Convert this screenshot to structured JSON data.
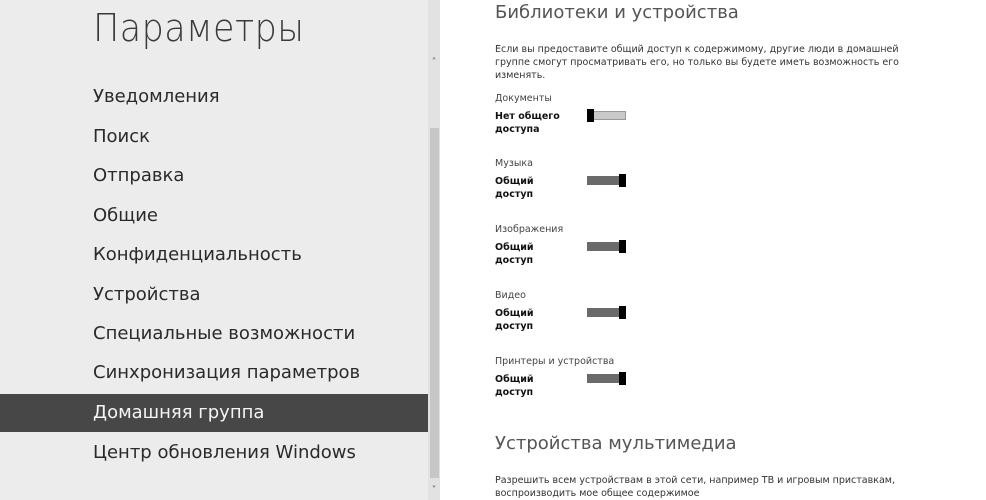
{
  "left": {
    "title": "Параметры",
    "items": [
      {
        "label": "Уведомления"
      },
      {
        "label": "Поиск"
      },
      {
        "label": "Отправка"
      },
      {
        "label": "Общие"
      },
      {
        "label": "Конфиденциальность"
      },
      {
        "label": "Устройства"
      },
      {
        "label": "Специальные возможности"
      },
      {
        "label": "Синхронизация параметров"
      },
      {
        "label": "Домашняя группа",
        "selected": true
      },
      {
        "label": "Центр обновления Windows"
      }
    ],
    "scroll_up": "˄",
    "scroll_down": "˅"
  },
  "right": {
    "section_title": "Библиотеки и устройства",
    "section_desc": "Если вы предоставите общий доступ к содержимому, другие люди в домашней группе смогут просматривать его, но только вы будете иметь возможность его изменять.",
    "libraries": [
      {
        "name": "Документы",
        "state": "Нет общего доступа",
        "on": false
      },
      {
        "name": "Музыка",
        "state": "Общий доступ",
        "on": true
      },
      {
        "name": "Изображения",
        "state": "Общий доступ",
        "on": true
      },
      {
        "name": "Видео",
        "state": "Общий доступ",
        "on": true
      },
      {
        "name": "Принтеры и устройства",
        "state": "Общий доступ",
        "on": true
      }
    ],
    "media_title": "Устройства мультимедиа",
    "media_desc": "Разрешить всем устройствам в этой сети, например ТВ и игровым приставкам, воспроизводить мое общее содержимое"
  }
}
